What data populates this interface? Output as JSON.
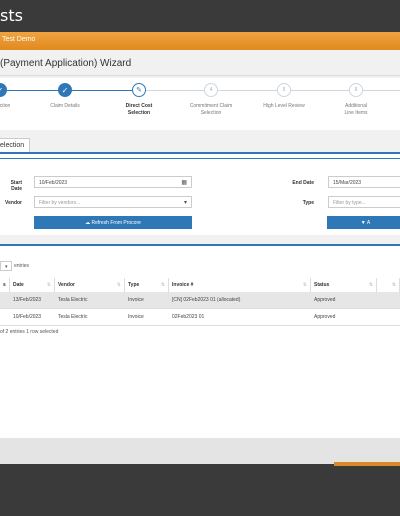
{
  "header": {
    "title": "sts"
  },
  "banner": {
    "text": "Test Demo"
  },
  "wizard": {
    "title": "(Payment Application) Wizard",
    "steps": [
      {
        "label": "Selection",
        "state": "done"
      },
      {
        "label": "Claim Details",
        "state": "done"
      },
      {
        "label": "Direct Cost\nSelection",
        "state": "active"
      },
      {
        "label": "Commitment Claim\nSelection",
        "state": "pending",
        "number": "4"
      },
      {
        "label": "High Level Review",
        "state": "pending",
        "number": "5"
      },
      {
        "label": "Additional\nLine Items",
        "state": "pending",
        "number": "6"
      }
    ]
  },
  "section": {
    "tab_label": "election"
  },
  "form": {
    "start_date_label": "Start Date",
    "start_date_value": "10/Feb/2023",
    "end_date_label": "End Date",
    "end_date_value": "15/Mar/2023",
    "vendor_label": "Vendor",
    "vendor_placeholder": "Filter by vendors...",
    "type_label": "Type",
    "type_placeholder": "Filter by type...",
    "refresh_button": "Refresh From Procore",
    "apply_button": "A"
  },
  "table": {
    "entries_label": "entries",
    "columns": [
      "s",
      "Date",
      "Vendor",
      "Type",
      "Invoice #",
      "Status"
    ],
    "rows": [
      {
        "date": "13/Feb/2023",
        "vendor": "Tesla Electric",
        "type": "Invoice",
        "invoice": "[CN] 02Feb2023 01 (allocated)",
        "status": "Approved",
        "selected": true
      },
      {
        "date": "10/Feb/2023",
        "vendor": "Tesla Electric",
        "type": "Invoice",
        "invoice": "02Feb2023 01",
        "status": "Approved",
        "selected": false
      }
    ],
    "info": "of 2 entries    1 row selected"
  },
  "colors": {
    "accent": "#2f78b7",
    "banner": "#e8952a",
    "selected_row": "#e6e6e6"
  }
}
